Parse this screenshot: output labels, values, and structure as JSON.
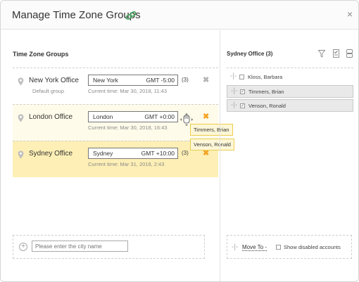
{
  "dialog": {
    "title": "Manage Time Zone Groups",
    "close_icon": "×"
  },
  "left": {
    "section_title": "Time Zone Groups",
    "groups": [
      {
        "name": "New York Office",
        "subtitle": "Default group",
        "city": "New York",
        "gmt": "GMT -5:00",
        "count": "(3)",
        "current_time": "Current time: Mar 30, 2018, 11:43",
        "delete_icon": "✖"
      },
      {
        "name": "London Office",
        "subtitle": "",
        "city": "London",
        "gmt": "GMT +0:00",
        "count": "(3)",
        "current_time": "Current time: Mar 30, 2018, 16:43",
        "delete_icon": "✖"
      },
      {
        "name": "Sydney Office",
        "subtitle": "",
        "city": "Sydney",
        "gmt": "GMT +10:00",
        "count": "(3)",
        "current_time": "Current time: Mar 31, 2018, 2:43",
        "delete_icon": "✖"
      }
    ],
    "drag_tooltips": [
      "Timmers, Brian",
      "Venson, Ronald"
    ],
    "add_city": {
      "placeholder": "Please enter the city name",
      "plus_icon": "+"
    }
  },
  "right": {
    "title": "Sydney Office (3)",
    "members": [
      {
        "name": "Kloss, Barbara",
        "checked": false,
        "mark": ""
      },
      {
        "name": "Timmers, Brian",
        "checked": true,
        "mark": "✓"
      },
      {
        "name": "Venson, Ronald",
        "checked": true,
        "mark": "✓"
      }
    ],
    "move_icon": "-|-",
    "footer": {
      "move_to": "Move To -",
      "show_disabled": "Show disabled accounts"
    }
  },
  "colors": {
    "london_bg": "#fefbea",
    "sydney_bg": "#fdefb5",
    "tooltip_border": "#eccd4d",
    "delete_orange": "#f4a426",
    "link_icon_green": "#4aa564"
  }
}
